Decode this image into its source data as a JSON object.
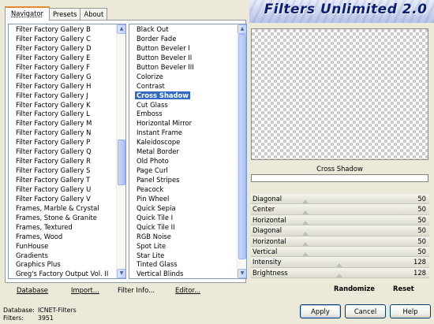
{
  "tabs": [
    "Navigator",
    "Presets",
    "About"
  ],
  "banner_title": "Filters Unlimited 2.0",
  "categories": [
    "Filter Factory Gallery B",
    "Filter Factory Gallery C",
    "Filter Factory Gallery D",
    "Filter Factory Gallery E",
    "Filter Factory Gallery F",
    "Filter Factory Gallery G",
    "Filter Factory Gallery H",
    "Filter Factory Gallery J",
    "Filter Factory Gallery K",
    "Filter Factory Gallery L",
    "Filter Factory Gallery M",
    "Filter Factory Gallery N",
    "Filter Factory Gallery P",
    "Filter Factory Gallery Q",
    "Filter Factory Gallery R",
    "Filter Factory Gallery S",
    "Filter Factory Gallery T",
    "Filter Factory Gallery U",
    "Filter Factory Gallery V",
    "Frames, Marble & Crystal",
    "Frames, Stone & Granite",
    "Frames, Textured",
    "Frames, Wood",
    "FunHouse",
    "Gradients",
    "Graphics Plus",
    "Greg's Factory Output Vol. II"
  ],
  "filters": [
    "Black Out",
    "Border Fade",
    "Button Beveler I",
    "Button Beveler II",
    "Button Beveler III",
    "Colorize",
    "Contrast",
    "Cross Shadow",
    "Cut Glass",
    "Emboss",
    "Horizontal Mirror",
    "Instant Frame",
    "Kaleidoscope",
    "Metal Border",
    "Old Photo",
    "Page Curl",
    "Panel Stripes",
    "Peacock",
    "Pin Wheel",
    "Quick Sepia",
    "Quick Tile I",
    "Quick Tile II",
    "RGB Noise",
    "Spot Lite",
    "Star Lite",
    "Tinted Glass",
    "Vertical Blinds"
  ],
  "selected_filter": "Cross Shadow",
  "selected_filter_index": 7,
  "category_scroll_position": 0.5,
  "filter_scroll_position": 0.0,
  "buttons": {
    "database": "Database",
    "import": "Import...",
    "filter_info": "Filter Info...",
    "editor": "Editor...",
    "randomize": "Randomize",
    "reset": "Reset",
    "apply": "Apply",
    "cancel": "Cancel",
    "help": "Help"
  },
  "info": {
    "database_label": "Database:",
    "database_value": "ICNET-Filters",
    "filters_label": "Filters:",
    "filters_value": "3951"
  },
  "parameters": [
    {
      "label": "Diagonal",
      "value": 50
    },
    {
      "label": "Center",
      "value": 50
    },
    {
      "label": "Horizontal",
      "value": 50
    },
    {
      "label": "Diagonal",
      "value": 50
    },
    {
      "label": "Horizontal",
      "value": 50
    },
    {
      "label": "Vertical",
      "value": 50
    },
    {
      "label": "Intensity",
      "value": 128
    },
    {
      "label": "Brightness",
      "value": 128
    }
  ],
  "preview_filter_name": "Cross Shadow"
}
